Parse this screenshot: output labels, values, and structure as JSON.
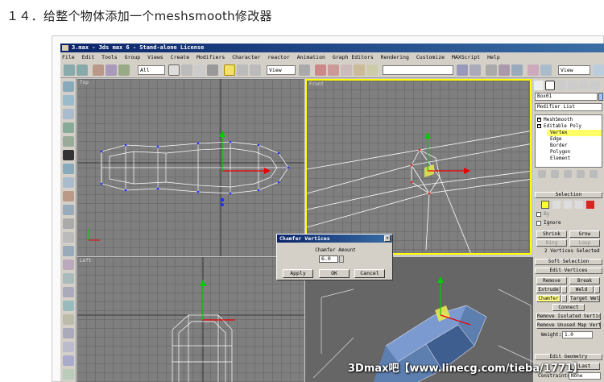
{
  "caption": "１４．给整个物体添加一个meshsmooth修改器",
  "window": {
    "title": "3.max - 3ds max 6 - Stand-alone License"
  },
  "menu": [
    "File",
    "Edit",
    "Tools",
    "Group",
    "Views",
    "Create",
    "Modifiers",
    "Character",
    "reactor",
    "Animation",
    "Graph Editors",
    "Rendering",
    "Customize",
    "MAXScript",
    "Help"
  ],
  "toolbar": {
    "selection_filter": "All",
    "ref_coord": "View",
    "named_selection": "",
    "right_view": "View"
  },
  "viewports": {
    "top": "Top",
    "front": "Front",
    "left": "Left",
    "perspective": ""
  },
  "command_panel": {
    "object_name": "Box01",
    "modifier_list": "Modifier List",
    "stack": [
      {
        "label": "MeshSmooth",
        "selected": false
      },
      {
        "label": "Editable Poly",
        "selected": false
      },
      {
        "label": "Vertex",
        "selected": true
      },
      {
        "label": "Edge",
        "selected": false
      },
      {
        "label": "Border",
        "selected": false
      },
      {
        "label": "Polygon",
        "selected": false
      },
      {
        "label": "Element",
        "selected": false
      }
    ],
    "selection_rollout": "Selection",
    "by_label": "By",
    "ignore_label": "Ignore",
    "shrink": "Shrink",
    "grow": "Grow",
    "ring": "Ring",
    "loop": "Loop",
    "status": "2 Vertices Selected",
    "soft_selection": "Soft Selection",
    "edit_vertices": "Edit Vertices",
    "remove": "Remove",
    "break": "Break",
    "extrude": "Extrude",
    "weld": "Weld",
    "chamfer": "Chamfer",
    "target_weld": "Target Weld",
    "connect": "Connect",
    "remove_isolated": "Remove Isolated Vertices",
    "remove_unused": "Remove Unused Map Verts",
    "weight_label": "Weight:",
    "weight_value": "1.0",
    "edit_geometry": "Edit Geometry",
    "last": "Last",
    "constraints_label": "Constraints:",
    "constraints_value": "None"
  },
  "dialog": {
    "title": "Chamfer Vertices",
    "amount_label": "Chamfer Amount",
    "amount_value": "6.0",
    "apply": "Apply",
    "ok": "OK",
    "cancel": "Cancel"
  },
  "watermark": "3Dmax吧【www.linecg.com/tieba/1771】",
  "colors": {
    "viewport_bg": "#7f7f7f",
    "active_border": "#ffff00",
    "selected_stack": "#ffff66",
    "titlebar": "#0a246a"
  }
}
